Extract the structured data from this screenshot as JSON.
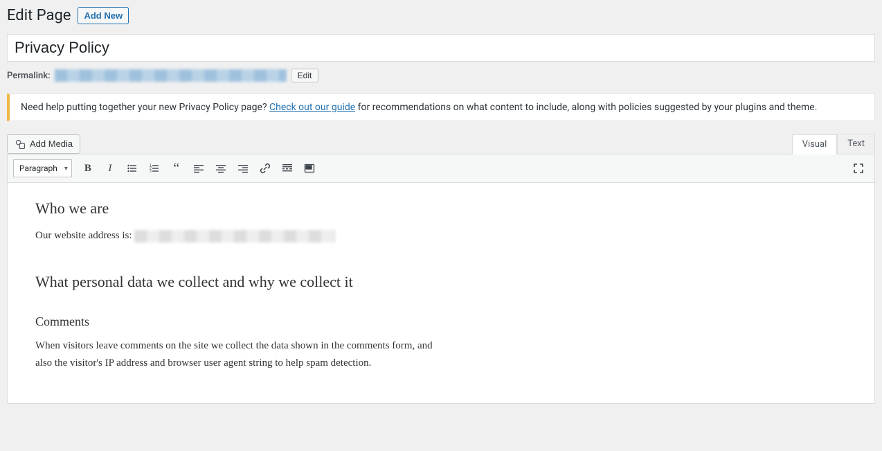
{
  "header": {
    "title": "Edit Page",
    "add_new": "Add New"
  },
  "title_field": {
    "value": "Privacy Policy"
  },
  "permalink": {
    "label": "Permalink:",
    "edit": "Edit"
  },
  "notice": {
    "text_before": "Need help putting together your new Privacy Policy page? ",
    "link": "Check out our guide",
    "text_after": " for recommendations on what content to include, along with policies suggested by your plugins and theme."
  },
  "media": {
    "add_media": "Add Media"
  },
  "tabs": {
    "visual": "Visual",
    "text": "Text"
  },
  "toolbar": {
    "format": "Paragraph"
  },
  "content": {
    "h2_who": "Who we are",
    "p_address_prefix": "Our website address is: ",
    "h2_data": "What personal data we collect and why we collect it",
    "h3_comments": "Comments",
    "p_comments": "When visitors leave comments on the site we collect the data shown in the comments form, and also the visitor's IP address and browser user agent string to help spam detection."
  }
}
